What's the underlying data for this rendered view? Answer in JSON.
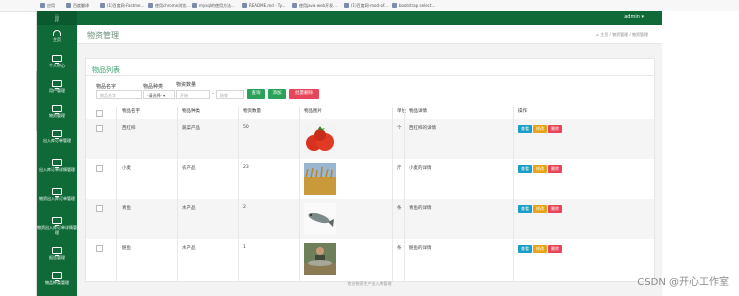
{
  "browser": {
    "bookmarks": [
      "应用",
      "百度翻译",
      "(1)百度网-Fastme...",
      "使用chrome浏览...",
      "mysql的使用方法...",
      "README.md - Ty...",
      "使用java-web开发...",
      "(1)百度网-mod-of...",
      "bootstrap select..."
    ]
  },
  "sidebar": {
    "logo": "jj",
    "items": [
      {
        "label": "主页",
        "icon": "dashboard-icon"
      },
      {
        "label": "个人中心",
        "icon": "monitor-icon"
      },
      {
        "label": "用户管理",
        "icon": "monitor-icon"
      },
      {
        "label": "物资管理",
        "icon": "monitor-icon"
      },
      {
        "label": "出入库订单管理",
        "icon": "monitor-icon"
      },
      {
        "label": "出入库订单详情管理",
        "icon": "monitor-icon"
      },
      {
        "label": "物资出入库订单管理",
        "icon": "monitor-icon"
      },
      {
        "label": "物资出入库订单详情管理",
        "icon": "monitor-icon"
      },
      {
        "label": "报告管理",
        "icon": "monitor-icon"
      },
      {
        "label": "物品种类管理",
        "icon": "monitor-icon"
      }
    ]
  },
  "topbar": {
    "user": "admin ▾"
  },
  "page": {
    "title": "物资管理",
    "breadcrumb": "⌂ 主页  /  物资管理  /  物资管理"
  },
  "card": {
    "title": "物品列表",
    "filters": {
      "name_label": "物品名字",
      "name_placeholder": "物品名字",
      "type_label": "物品种类",
      "type_value": "-请选择- ▾",
      "count_label": "物资数量",
      "count_start": "开始",
      "count_sep": "-",
      "count_end": "结束"
    },
    "buttons": {
      "search": "查询",
      "add": "添加",
      "batch_delete": "批量删除"
    },
    "columns": [
      "物品名字",
      "物品种类",
      "物资数量",
      "物品图片",
      "单位",
      "物品详情",
      "操作"
    ],
    "rows": [
      {
        "name": "西红柿",
        "type": "蔬菜产品",
        "count": "50",
        "unit": "个",
        "detail": "西红柿的详情",
        "image": "tomato",
        "actions": [
          "查看",
          "修改",
          "删除"
        ]
      },
      {
        "name": "小麦",
        "type": "农产品",
        "count": "23",
        "unit": "斤",
        "detail": "小麦的详情",
        "image": "wheat",
        "actions": [
          "查看",
          "修改",
          "删除"
        ]
      },
      {
        "name": "青鱼",
        "type": "水产品",
        "count": "2",
        "unit": "条",
        "detail": "青鱼的详情",
        "image": "fish",
        "actions": [
          "查看",
          "修改",
          "删除"
        ]
      },
      {
        "name": "鲢鱼",
        "type": "水产品",
        "count": "1",
        "unit": "条",
        "detail": "鲢鱼的详情",
        "image": "fish-photo",
        "actions": [
          "查看",
          "修改",
          "删除"
        ]
      }
    ]
  },
  "footer": "农业物资生产出入库管理",
  "watermark": "CSDN @开心工作室",
  "colors": {
    "sidebar": "#0f6a38",
    "view": "#1aa0c8",
    "edit": "#e8a317",
    "delete": "#e8455a",
    "search": "#2aa25a",
    "add": "#2aa25a",
    "batch": "#e8455a"
  }
}
